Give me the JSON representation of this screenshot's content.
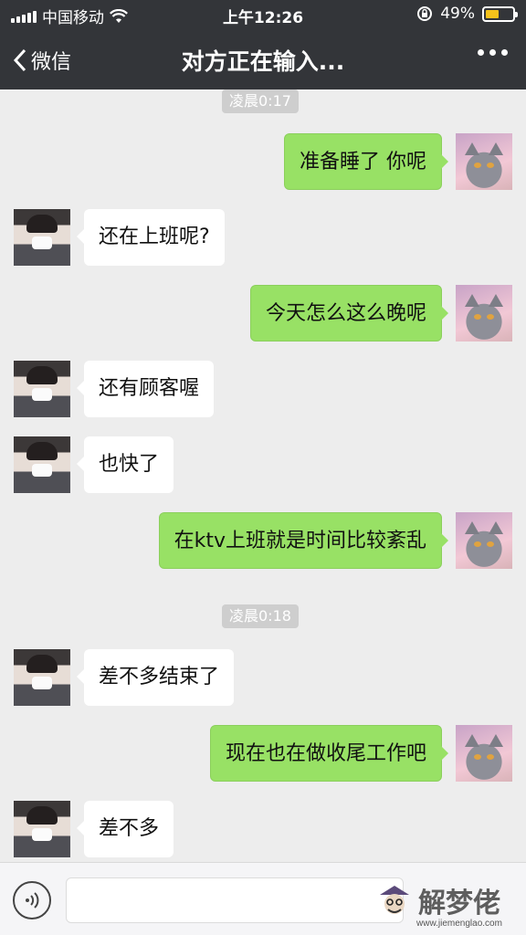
{
  "status_bar": {
    "carrier": "中国移动",
    "time": "上午12:26",
    "battery_percent": "49%",
    "battery_level": 0.49
  },
  "nav": {
    "back_label": "微信",
    "title": "对方正在输入..."
  },
  "timestamps": [
    "凌晨0:17",
    "凌晨0:18"
  ],
  "messages": [
    {
      "side": "out",
      "text": "准备睡了 你呢"
    },
    {
      "side": "in",
      "text": "还在上班呢?"
    },
    {
      "side": "out",
      "text": "今天怎么这么晚呢"
    },
    {
      "side": "in",
      "text": "还有顾客喔"
    },
    {
      "side": "in",
      "text": "也快了"
    },
    {
      "side": "out",
      "text": "在ktv上班就是时间比较紊乱"
    },
    {
      "side": "in",
      "text": "差不多结束了"
    },
    {
      "side": "out",
      "text": "现在也在做收尾工作吧"
    },
    {
      "side": "in",
      "text": "差不多"
    }
  ],
  "watermark": {
    "brand": "解梦佬",
    "url": "www.jiemenglao.com"
  },
  "colors": {
    "bar": "#333539",
    "background": "#ededed",
    "outgoing_bubble": "#98e165",
    "incoming_bubble": "#ffffff",
    "battery": "#f5c21b"
  },
  "icons": [
    "signal-icon",
    "wifi-icon",
    "lock-rotation-icon",
    "battery-icon",
    "chevron-left-icon",
    "more-icon",
    "voice-icon"
  ]
}
